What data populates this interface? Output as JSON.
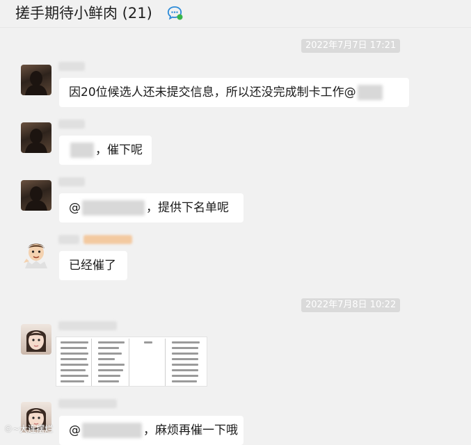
{
  "header": {
    "title": "搓手期待小鲜肉 (21)"
  },
  "time_separators": [
    "2022年7月7日 17:21",
    "2022年7月8日 10:22"
  ],
  "messages": [
    {
      "text": "因20位候选人还未提交信息，所以还没完成制卡工作@"
    },
    {
      "text": "，催下呢"
    },
    {
      "prefix": "@",
      "text": "，提供下名单呢"
    },
    {
      "text": "已经催了"
    },
    {
      "prefix": "@",
      "text": "，麻烦再催一下哦"
    }
  ],
  "watermark": "©~大连摆烂"
}
